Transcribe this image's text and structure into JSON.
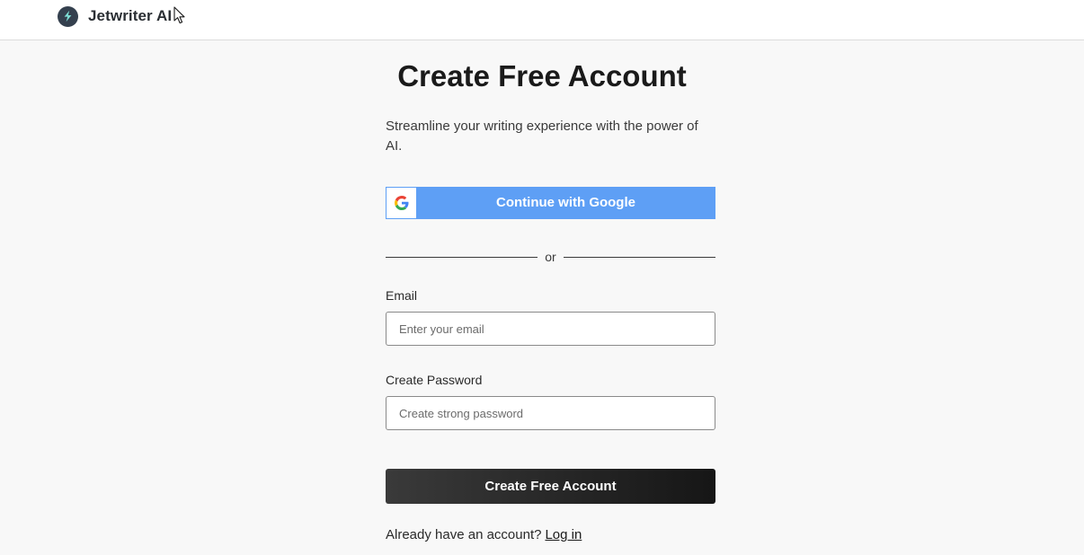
{
  "brand": {
    "name": "Jetwriter AI",
    "logo_color": "#34404e"
  },
  "heading": {
    "title": "Create Free Account",
    "subtitle": "Streamline your writing experience with the power of AI."
  },
  "google": {
    "label": "Continue with Google",
    "color": "#5e9ff5"
  },
  "divider": {
    "text": "or"
  },
  "form": {
    "email": {
      "label": "Email",
      "placeholder": "Enter your email",
      "value": ""
    },
    "password": {
      "label": "Create Password",
      "placeholder": "Create strong password",
      "value": ""
    },
    "submit_label": "Create Free Account"
  },
  "footer": {
    "prompt": "Already have an account?",
    "login_label": "Log in"
  }
}
